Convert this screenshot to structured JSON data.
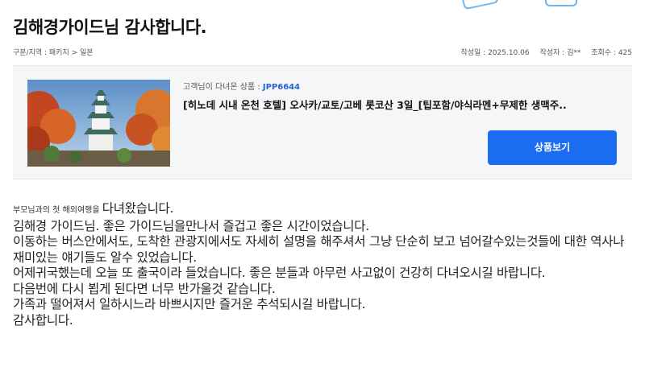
{
  "post": {
    "title": "김해경가이드님 감사합니다.",
    "breadcrumb": "구분/지역 : 패키지 > 일본",
    "date": "작성일 : 2025.10.06",
    "author": "작성자 : 김**",
    "views": "조회수 : 425"
  },
  "product": {
    "label": "고객님이 다녀온 상품 : ",
    "code": "JPP6644",
    "title": "[히노데 시내 온천 호텔] 오사카/교토/고베 롯코산 3일_[팁포함/야식라멘+무제한 생맥주..",
    "button_label": "상품보기"
  },
  "review": {
    "intro_small": "부모님과의 첫 해외여행을 ",
    "intro_large": "다녀왔습니다.",
    "lines": [
      "김해경 가이드님. 좋은 가이드님을만나서 즐겁고 좋은 시간이었습니다.",
      "이동하는 버스안에서도, 도착한 관광지에서도 자세히 설명을 해주셔서 그냥 단순히 보고 넘어갈수있는것들에 대한 역사나 재미있는 얘기들도 알수 있었습니다.",
      "어제귀국했는데 오늘 또 출국이라 들었습니다. 좋은 분들과 아무런 사고없이 건강히 다녀오시길 바랍니다.",
      "다음번에 다시 뵙게 된다면 너무 반가울것 같습니다.",
      "가족과 떨어져서 일하시느라 바쁘시지만 즐거운 추석되시길 바랍니다.",
      "감사합니다."
    ]
  },
  "colors": {
    "accent": "#1a6cf0",
    "code": "#2463d6",
    "box_bg": "#f5f6f8"
  }
}
